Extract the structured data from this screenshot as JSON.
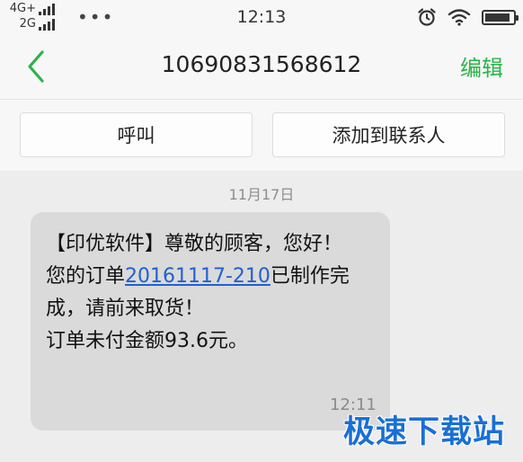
{
  "status_bar": {
    "network_top": "4G+",
    "network_bottom": "2G",
    "more_dots": "•••",
    "time": "12:13",
    "battery_level": 0.9
  },
  "header": {
    "title": "10690831568612",
    "edit_label": "编辑"
  },
  "actions": {
    "call_label": "呼叫",
    "add_contact_label": "添加到联系人"
  },
  "conversation": {
    "date": "11月17日",
    "message": {
      "part1": "【印优软件】尊敬的顾客，您好！",
      "part2": "您的订单",
      "link": "20161117-210",
      "part3": "已制作完成，请前来取货！",
      "part4": "订单未付金额93.6元。",
      "time": "12:11"
    }
  },
  "watermark": {
    "text": "极速下载站"
  },
  "colors": {
    "accent_green": "#2bb34a",
    "link_blue": "#2160d0",
    "bubble_gray": "#dadada",
    "watermark_blue": "#1a6fd4"
  }
}
